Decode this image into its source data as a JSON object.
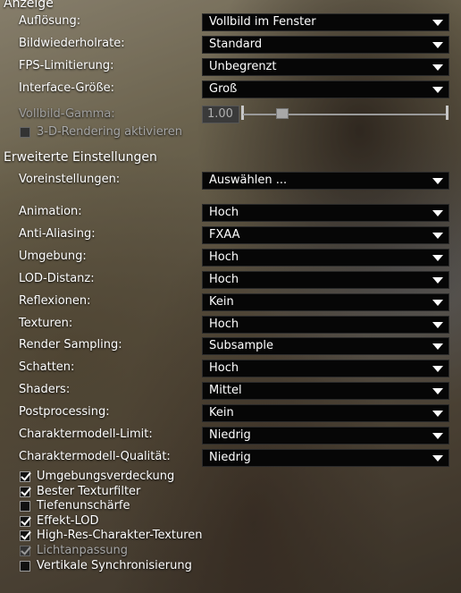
{
  "display": {
    "title": "Anzeige",
    "resolution": {
      "label": "Auflösung:",
      "value": "Vollbild im Fenster"
    },
    "refresh_rate": {
      "label": "Bildwiederholrate:",
      "value": "Standard"
    },
    "fps_limit": {
      "label": "FPS-Limitierung:",
      "value": "Unbegrenzt"
    },
    "interface_size": {
      "label": "Interface-Größe:",
      "value": "Groß"
    },
    "gamma": {
      "label": "Vollbild-Gamma:",
      "value": "1.00"
    },
    "render_3d": {
      "label": "3-D-Rendering aktivieren",
      "checked": false,
      "enabled": false
    }
  },
  "advanced": {
    "title": "Erweiterte Einstellungen",
    "preset": {
      "label": "Voreinstellungen:",
      "value": "Auswählen ..."
    },
    "rows": [
      {
        "label": "Animation:",
        "value": "Hoch"
      },
      {
        "label": "Anti-Aliasing:",
        "value": "FXAA"
      },
      {
        "label": "Umgebung:",
        "value": "Hoch"
      },
      {
        "label": "LOD-Distanz:",
        "value": "Hoch"
      },
      {
        "label": "Reflexionen:",
        "value": "Kein"
      },
      {
        "label": "Texturen:",
        "value": "Hoch"
      },
      {
        "label": "Render Sampling:",
        "value": "Subsample"
      },
      {
        "label": "Schatten:",
        "value": "Hoch"
      },
      {
        "label": "Shaders:",
        "value": "Mittel"
      },
      {
        "label": "Postprocessing:",
        "value": "Kein"
      },
      {
        "label": "Charaktermodell-Limit:",
        "value": "Niedrig"
      },
      {
        "label": "Charaktermodell-Qualität:",
        "value": "Niedrig"
      }
    ],
    "checkboxes": [
      {
        "label": "Umgebungsverdeckung",
        "checked": true,
        "enabled": true
      },
      {
        "label": "Bester Texturfilter",
        "checked": true,
        "enabled": true
      },
      {
        "label": "Tiefenunschärfe",
        "checked": false,
        "enabled": true
      },
      {
        "label": "Effekt-LOD",
        "checked": true,
        "enabled": true
      },
      {
        "label": "High-Res-Charakter-Texturen",
        "checked": true,
        "enabled": true
      },
      {
        "label": "Lichtanpassung",
        "checked": true,
        "enabled": false
      },
      {
        "label": "Vertikale Synchronisierung",
        "checked": false,
        "enabled": true
      }
    ]
  }
}
